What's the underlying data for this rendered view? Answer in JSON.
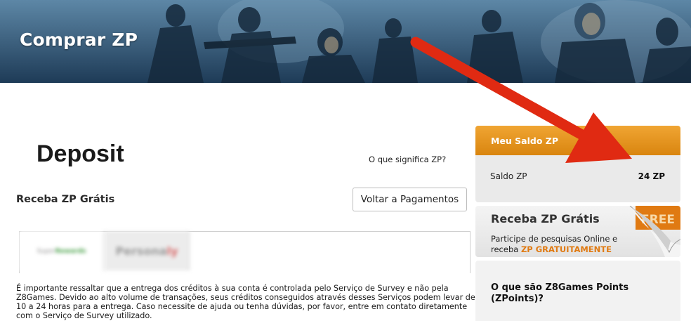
{
  "header": {
    "title": "Comprar ZP"
  },
  "main": {
    "page_title": "Deposit",
    "zp_link": "O que significa ZP?",
    "section_title": "Receba ZP Grátis",
    "back_button": "Voltar a Pagamentos",
    "tabs": [
      {
        "part1": "Super",
        "part2": "Rewards"
      },
      {
        "part1": "Persona",
        "part2": "ly"
      }
    ],
    "notice": "É importante ressaltar que a entrega dos créditos à sua conta é controlada pelo Serviço de Survey e não pela Z8Games. Devido ao alto volume de transações, seus créditos conseguidos através desses Serviços podem levar de 10 a 24 horas para a entrega. Caso necessite de ajuda ou tenha dúvidas, por favor, entre em contato diretamente com o Serviço de Survey utilizado."
  },
  "sidebar": {
    "balance": {
      "header": "Meu Saldo ZP",
      "label": "Saldo ZP",
      "value": "24 ZP"
    },
    "free": {
      "title": "Receba ZP Grátis",
      "desc_prefix": "Participe de pesquisas Online e receba ",
      "desc_highlight": "ZP GRATUITAMENTE",
      "badge": "FREE"
    },
    "points": {
      "title": "O que são Z8Games Points (ZPoints)?"
    }
  },
  "colors": {
    "banner": "#2b4f6e",
    "orange": "#e08a16",
    "highlight": "#e07a12",
    "arrow": "#e02a12"
  },
  "icons": [
    "banner-soldiers-illustration",
    "free-page-curl-icon",
    "annotation-arrow"
  ]
}
